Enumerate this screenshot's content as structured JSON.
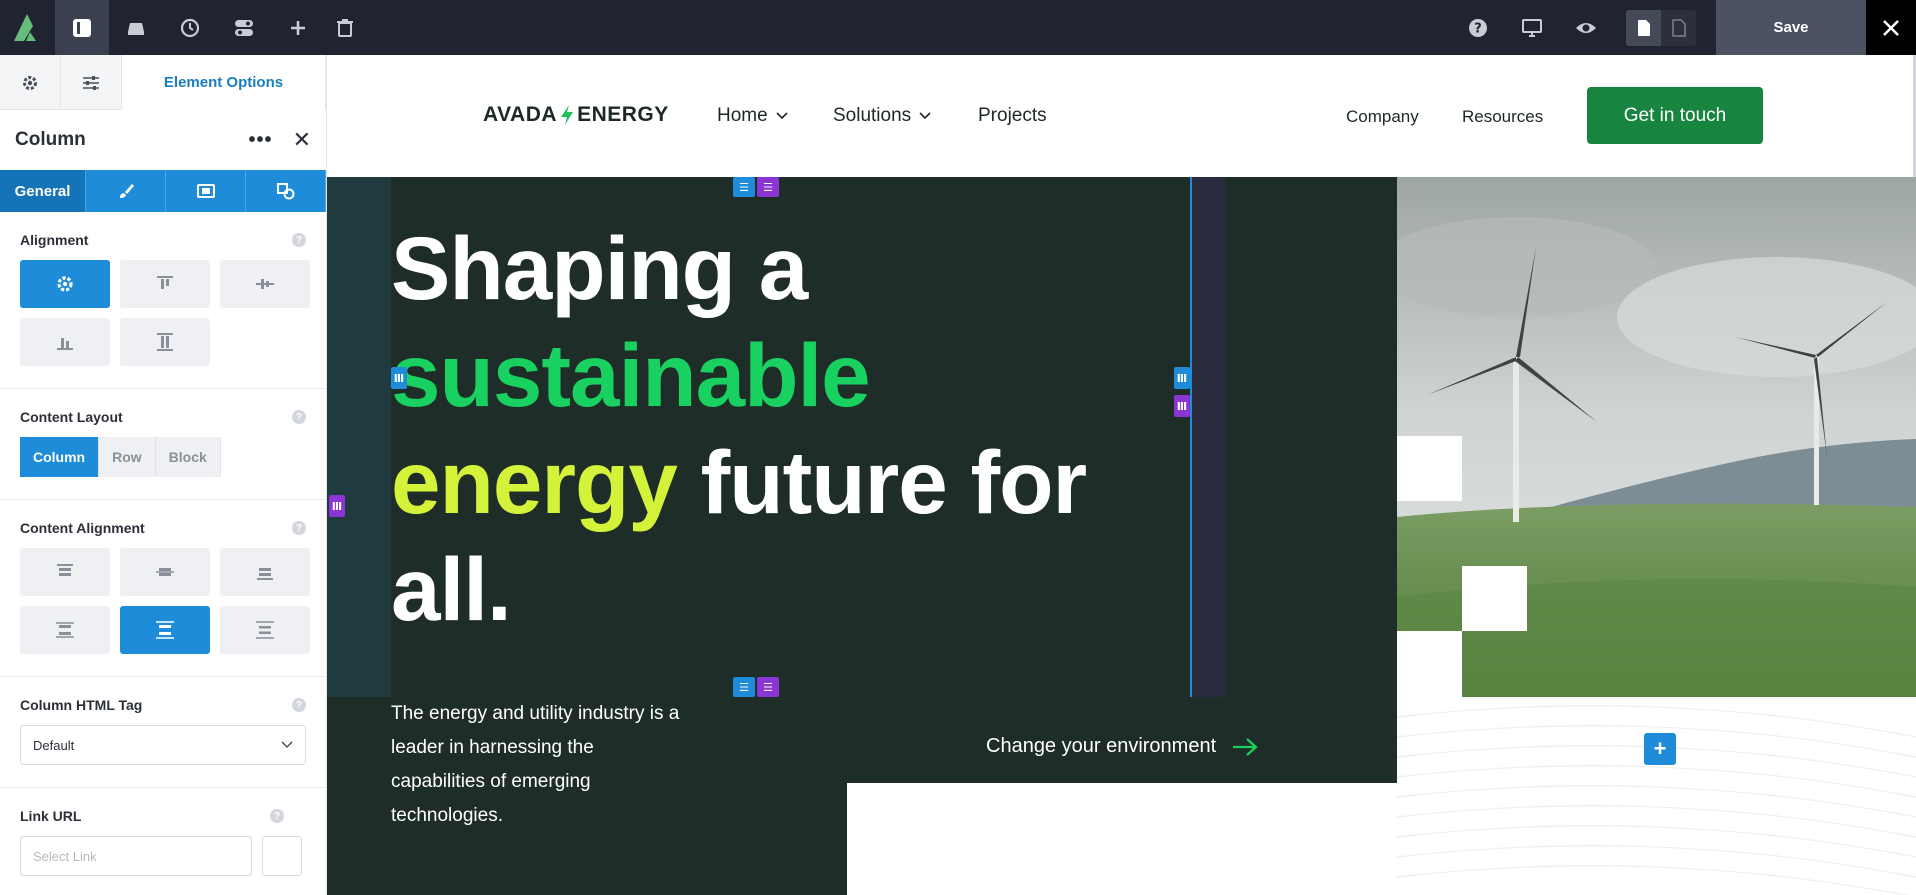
{
  "toolbar": {
    "logo_icon": "avada-logo-icon",
    "buttons": [
      "sidebar-toggle-icon",
      "library-icon",
      "history-icon",
      "toggle-icon",
      "plus-icon",
      "trash-icon"
    ],
    "right_icons": [
      "help-icon",
      "desktop-icon",
      "preview-eye-icon"
    ],
    "save_label": "Save",
    "close_label": "✕"
  },
  "sidebar": {
    "tabs": {
      "options_label": "Element Options"
    },
    "header": {
      "title": "Column",
      "dots": "•••",
      "close": "✕"
    },
    "subtabs": {
      "general": "General"
    },
    "alignment": {
      "label": "Alignment"
    },
    "content_layout": {
      "label": "Content Layout",
      "options": [
        "Column",
        "Row",
        "Block"
      ],
      "selected": "Column"
    },
    "content_alignment": {
      "label": "Content Alignment"
    },
    "html_tag": {
      "label": "Column HTML Tag",
      "value": "Default"
    },
    "link_url": {
      "label": "Link URL",
      "placeholder": "Select Link"
    },
    "help": "?"
  },
  "site": {
    "logo_left": "AVADA",
    "logo_right": "ENERGY",
    "nav": {
      "home": "Home",
      "solutions": "Solutions",
      "projects": "Projects",
      "company": "Company",
      "resources": "Resources"
    },
    "cta": "Get in touch",
    "headline": {
      "line1": "Shaping a",
      "line2": "sustainable",
      "line3a": "energy",
      "line3b": " future for",
      "line4": "all."
    },
    "paragraph": "The energy and utility industry is a leader in harnessing the capabilities of emerging technologies.",
    "change_link": "Change your environment"
  },
  "colors": {
    "accent_blue": "#1e8cd8",
    "hero_bg": "#1e2d27",
    "green": "#19d161",
    "lime": "#d5f23a",
    "cta_green": "#17843f",
    "purple": "#8a35d4"
  }
}
